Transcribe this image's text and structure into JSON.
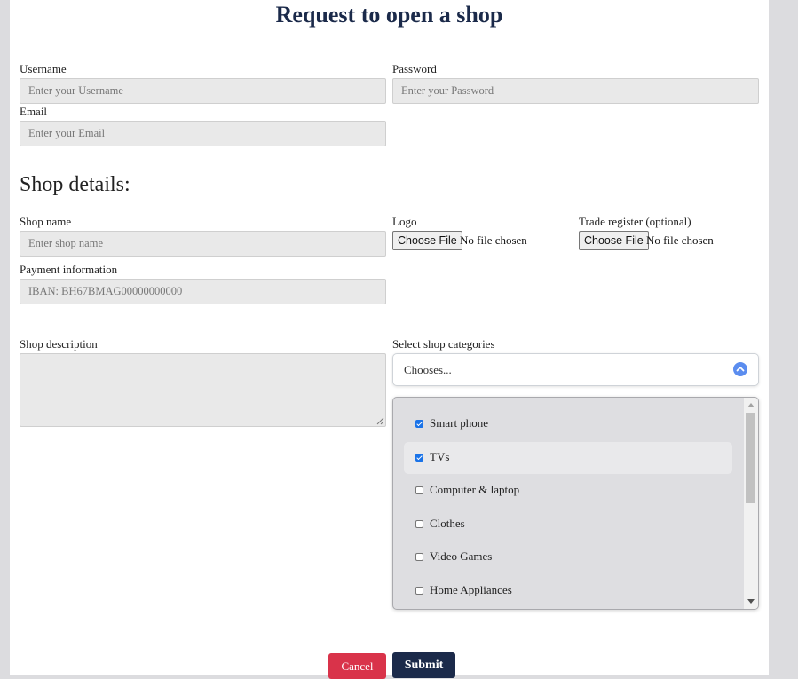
{
  "title": "Request to open a shop",
  "account": {
    "username_label": "Username",
    "username_placeholder": "Enter your Username",
    "password_label": "Password",
    "password_placeholder": "Enter your Password",
    "email_label": "Email",
    "email_placeholder": "Enter your Email"
  },
  "shop": {
    "section_title": "Shop details:",
    "name_label": "Shop name",
    "name_placeholder": "Enter shop name",
    "logo_label": "Logo",
    "logo_button": "Choose File",
    "logo_status": "No file chosen",
    "trade_label": "Trade register (optional)",
    "trade_button": "Choose File",
    "trade_status": "No file chosen",
    "payment_label": "Payment information",
    "payment_placeholder": "IBAN: BH67BMAG00000000000",
    "description_label": "Shop description",
    "categories_label": "Select shop categories",
    "categories_select": "Chooses...",
    "categories": [
      {
        "label": "Smart phone",
        "checked": true
      },
      {
        "label": "TVs",
        "checked": true
      },
      {
        "label": "Computer & laptop",
        "checked": false
      },
      {
        "label": "Clothes",
        "checked": false
      },
      {
        "label": "Video Games",
        "checked": false
      },
      {
        "label": "Home Appliances",
        "checked": false
      }
    ]
  },
  "actions": {
    "cancel": "Cancel",
    "submit": "Submit"
  },
  "colors": {
    "title": "#1b2a4a",
    "cancel": "#d9334a",
    "submit": "#1b2a4a",
    "checkbox": "#1a73e8"
  }
}
